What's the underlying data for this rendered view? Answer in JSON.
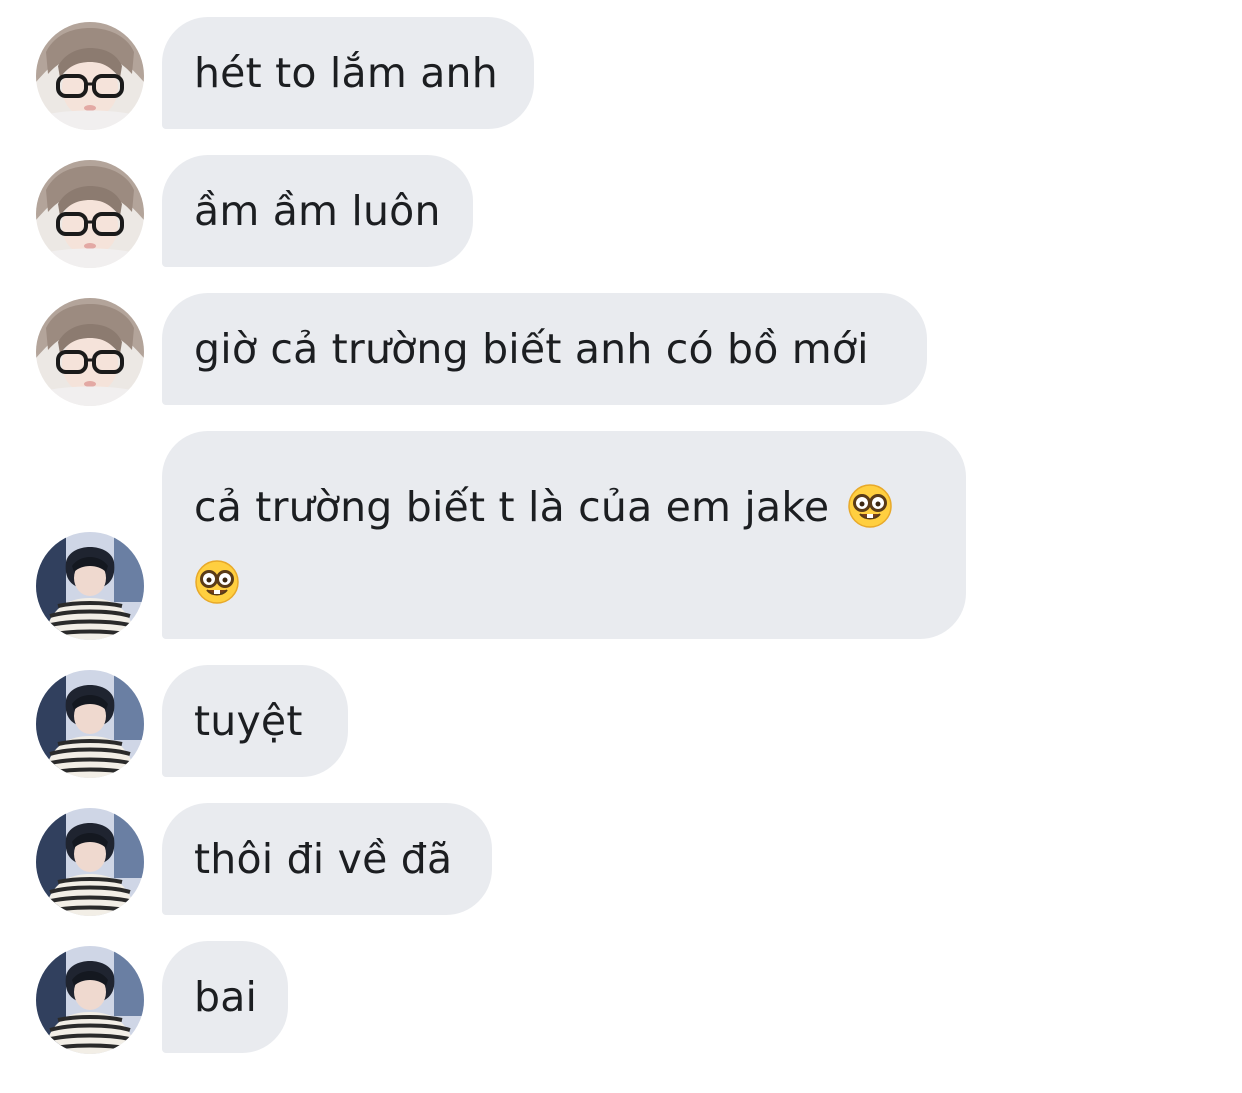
{
  "conversation": {
    "messages": [
      {
        "sender": "girl",
        "text": "hét to lắm anh"
      },
      {
        "sender": "girl",
        "text": "ầm ầm luôn"
      },
      {
        "sender": "girl",
        "text": "giờ cả trường biết anh có bồ mới"
      },
      {
        "sender": "boy",
        "text": "cả trường biết t là của em jake",
        "emojis": [
          "nerd-face",
          "nerd-face"
        ]
      },
      {
        "sender": "boy",
        "text": "tuyệt"
      },
      {
        "sender": "boy",
        "text": "thôi đi về đã"
      },
      {
        "sender": "boy",
        "text": "bai"
      }
    ]
  },
  "colors": {
    "bubble_bg": "#e9ebef",
    "text": "#1c1e21",
    "background": "#ffffff"
  }
}
